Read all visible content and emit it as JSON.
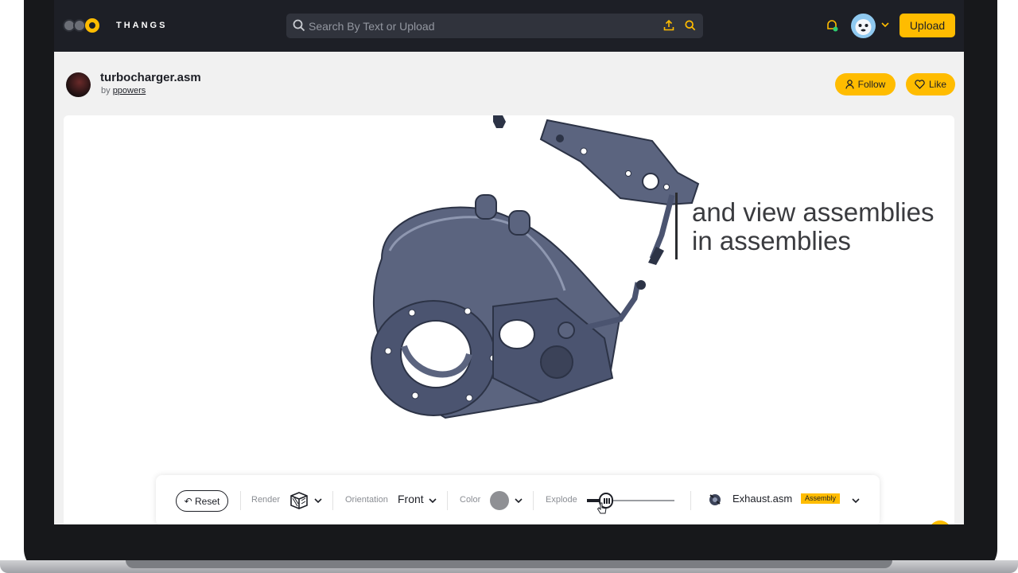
{
  "nav": {
    "brand": "THANGS",
    "search_placeholder": "Search By Text or Upload",
    "upload_label": "Upload"
  },
  "model": {
    "title": "turbocharger.asm",
    "by_prefix": "by",
    "author": "ppowers",
    "follow_label": "Follow",
    "like_label": "Like"
  },
  "viewer": {
    "caption_line1": "and view assemblies",
    "caption_line2": "in assemblies"
  },
  "toolbar": {
    "reset_label": "Reset",
    "render_label": "Render",
    "orientation_label": "Orientation",
    "orientation_value": "Front",
    "color_label": "Color",
    "color_value": "#8f9094",
    "explode_label": "Explode",
    "explode_level": 0.22,
    "assembly_name": "Exhaust.asm",
    "assembly_badge": "Assembly"
  },
  "colors": {
    "accent": "#ffbc00",
    "nav_bg": "#1d1f26",
    "model_steel": "#4b5470"
  }
}
